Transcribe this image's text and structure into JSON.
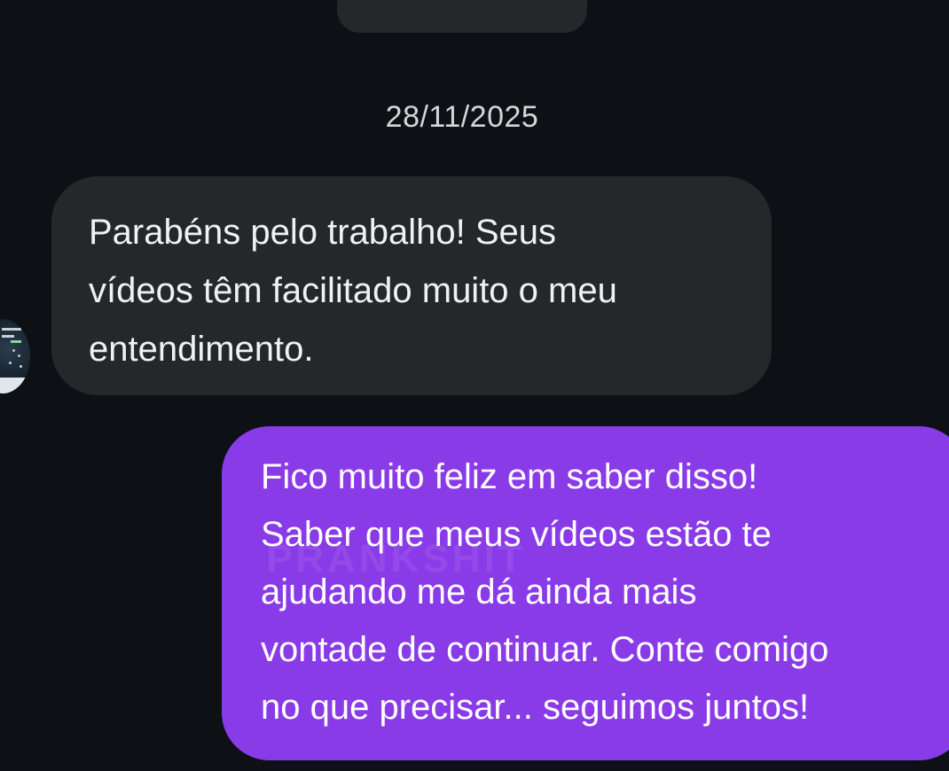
{
  "top_message": {
    "text": "· · · · ·"
  },
  "date_separator": "28/11/2025",
  "incoming_message": {
    "lines": [
      "Parabéns pelo trabalho! Seus",
      "vídeos têm facilitado muito o meu",
      "entendimento."
    ]
  },
  "outgoing_message": {
    "lines": [
      "Fico muito feliz em saber disso!",
      "Saber que meus vídeos estão te",
      "ajudando me dá ainda mais",
      "vontade de continuar. Conte comigo",
      "no que precisar... seguimos juntos!"
    ]
  },
  "watermark": "PRANKSHIT",
  "colors": {
    "background": "#0d1115",
    "incoming_bubble": "#25272b",
    "outgoing_bubble": "#8a3be8",
    "date_text": "#d4d5d8"
  }
}
